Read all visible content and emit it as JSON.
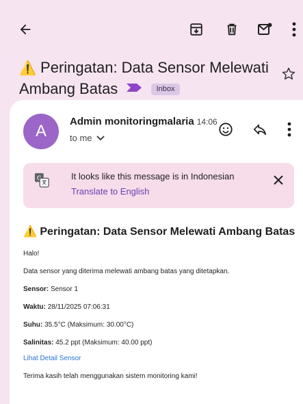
{
  "toolbar": {
    "back_icon": "arrow-back-icon",
    "archive_icon": "archive-icon",
    "delete_icon": "trash-icon",
    "mark_unread_icon": "mark-unread-icon",
    "more_icon": "more-vert-icon"
  },
  "subject": {
    "warning": "⚠️",
    "text": "Peringatan: Data Sensor Melewati Ambang Batas",
    "label": "Inbox"
  },
  "sender": {
    "avatar_letter": "A",
    "name": "Admin monitoringmalaria",
    "time": "14:06",
    "to": "to me"
  },
  "translate": {
    "message": "It looks like this message is in Indonesian",
    "link": "Translate to English"
  },
  "body": {
    "title": "Peringatan: Data Sensor Melewati Ambang Batas",
    "greeting": "Halo!",
    "intro": "Data sensor yang diterima melewati ambang batas yang ditetapkan.",
    "sensor_label": "Sensor:",
    "sensor_value": "Sensor 1",
    "waktu_label": "Waktu:",
    "waktu_value": "28/11/2025 07:06:31",
    "suhu_label": "Suhu:",
    "suhu_value": "35.5°C (Maksimum: 30.00°C)",
    "salinitas_label": "Salinitas:",
    "salinitas_value": "45.2 ppt (Maksimum: 40.00 ppt)",
    "detail_link": "Lihat Detail Sensor",
    "closing": "Terima kasih telah menggunakan sistem monitoring kami!"
  },
  "colors": {
    "background": "#f6e4f1",
    "avatar": "#9b66c7",
    "translate_bg": "#f7dcea",
    "link_purple": "#6a3fb0",
    "link_blue": "#2a74d4",
    "warning_yellow": "#f2b705"
  }
}
